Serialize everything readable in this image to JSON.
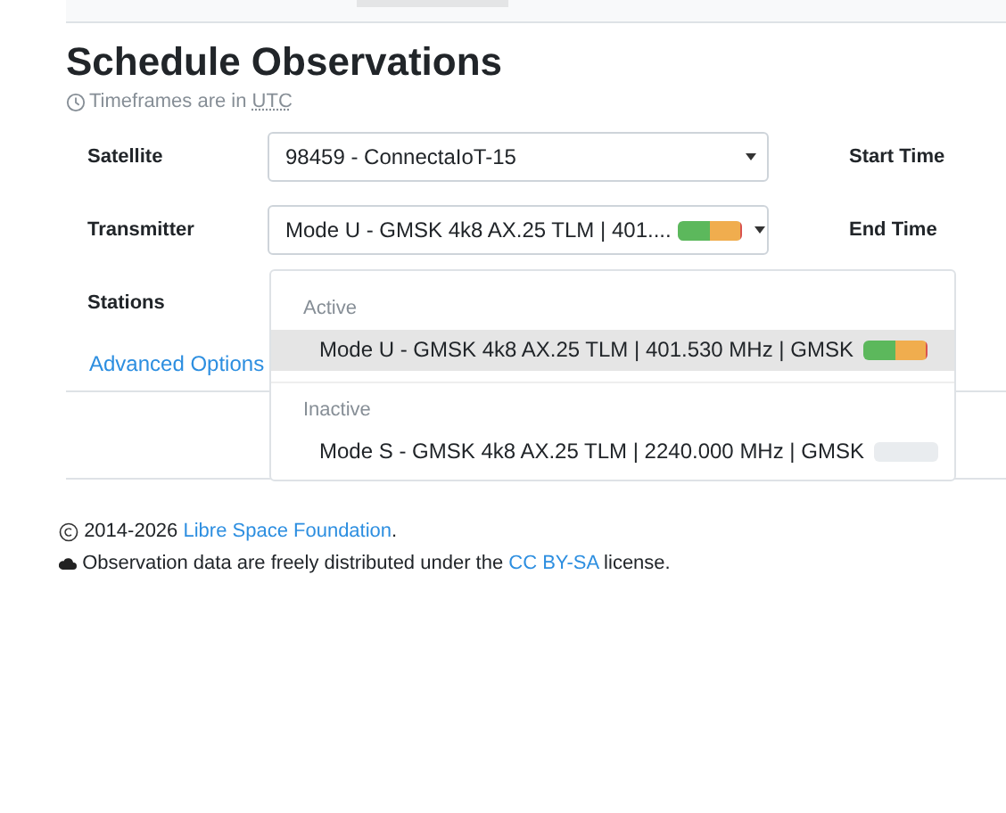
{
  "title": "Schedule Observations",
  "timezone_note": {
    "text": "Timeframes are in ",
    "abbr": "UTC"
  },
  "form": {
    "satellite": {
      "label": "Satellite",
      "value": "98459 - ConnectaIoT-15"
    },
    "transmitter": {
      "label": "Transmitter",
      "value": "Mode U - GMSK 4k8 AX.25 TLM | 401....",
      "status": [
        {
          "color": "#5cb85c",
          "level": 0.5
        },
        {
          "color": "#f0ad4e",
          "level": 0.46
        },
        {
          "color": "#d9534f",
          "level": 0.03
        }
      ]
    },
    "stations": {
      "label": "Stations"
    },
    "start_time": {
      "label": "Start Time"
    },
    "end_time": {
      "label": "End Time"
    },
    "advanced_link": "Advanced Options"
  },
  "dropdown": {
    "groups": [
      {
        "label": "Active",
        "options": [
          {
            "text": "Mode U - GMSK 4k8 AX.25 TLM | 401.530 MHz | GMSK",
            "selected": true,
            "status": [
              {
                "color": "#5cb85c",
                "level": 0.5
              },
              {
                "color": "#f0ad4e",
                "level": 0.46
              },
              {
                "color": "#d9534f",
                "level": 0.03
              }
            ]
          }
        ]
      },
      {
        "label": "Inactive",
        "options": [
          {
            "text": "Mode S - GMSK 4k8 AX.25 TLM | 2240.000 MHz | GMSK",
            "selected": false
          }
        ]
      }
    ]
  },
  "footer": {
    "copyright": {
      "text": "2014-2026 ",
      "link": "Libre Space Foundation",
      "after": "."
    },
    "license": {
      "text": "Observation data are freely distributed under the ",
      "link": "CC BY-SA",
      "after": " license."
    }
  }
}
